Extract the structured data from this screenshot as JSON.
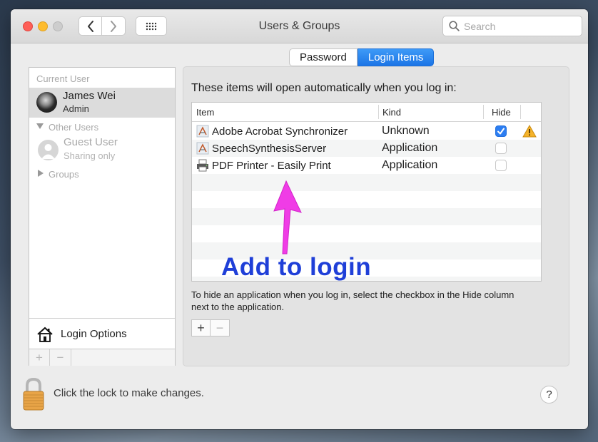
{
  "window": {
    "title": "Users & Groups",
    "search_placeholder": "Search"
  },
  "sidebar": {
    "current_user_label": "Current User",
    "current_user": {
      "name": "James Wei",
      "role": "Admin"
    },
    "other_users_label": "Other Users",
    "guest": {
      "name": "Guest User",
      "status": "Sharing only"
    },
    "groups_label": "Groups",
    "login_options_label": "Login Options",
    "add_symbol": "+",
    "remove_symbol": "−"
  },
  "tabs": [
    {
      "label": "Password",
      "active": false
    },
    {
      "label": "Login Items",
      "active": true
    }
  ],
  "login_items": {
    "intro": "These items will open automatically when you log in:",
    "columns": {
      "item": "Item",
      "kind": "Kind",
      "hide": "Hide"
    },
    "rows": [
      {
        "item": "Adobe Acrobat Synchronizer",
        "kind": "Unknown",
        "hide": true,
        "warning": true
      },
      {
        "item": "SpeechSynthesisServer",
        "kind": "Application",
        "hide": false,
        "warning": false
      },
      {
        "item": "PDF Printer - Easily Print",
        "kind": "Application",
        "hide": false,
        "warning": false
      }
    ],
    "hint": "To hide an application when you log in, select the checkbox in the Hide column next to the application.",
    "add_symbol": "+",
    "remove_symbol": "−"
  },
  "footer": {
    "lock_text": "Click the lock to make changes.",
    "help_symbol": "?"
  },
  "annotation": {
    "text": "Add to login",
    "color": "#1f3fd8",
    "arrow_color": "#f03ce6"
  }
}
